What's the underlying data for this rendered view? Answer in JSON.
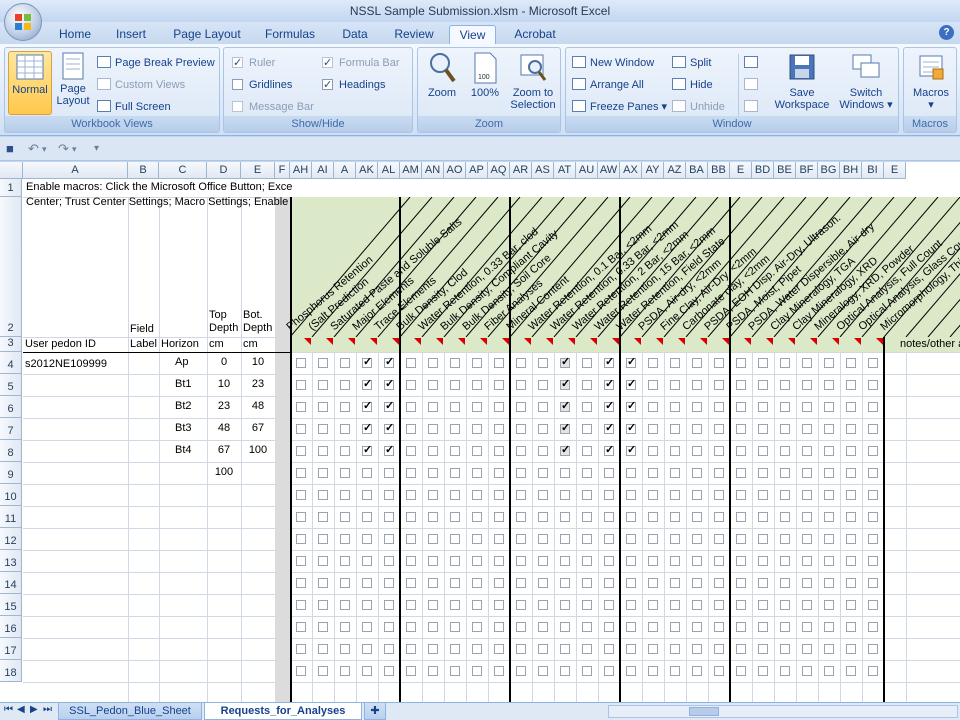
{
  "window": {
    "title": "NSSL Sample Submission.xlsm - Microsoft Excel",
    "help": "?"
  },
  "tabs": [
    "Home",
    "Insert",
    "Page Layout",
    "Formulas",
    "Data",
    "Review",
    "View",
    "Acrobat"
  ],
  "active_tab": "View",
  "ribbon": {
    "workbook_views": {
      "label": "Workbook Views",
      "normal": "Normal",
      "page_layout": "Page Layout",
      "page_break_preview": "Page Break Preview",
      "custom_views": "Custom Views",
      "full_screen": "Full Screen"
    },
    "show_hide": {
      "label": "Show/Hide",
      "ruler": "Ruler",
      "formula_bar": "Formula Bar",
      "gridlines": "Gridlines",
      "headings": "Headings",
      "message_bar": "Message Bar"
    },
    "zoom": {
      "label": "Zoom",
      "zoom": "Zoom",
      "hundred": "100%",
      "zoom_to_selection": "Zoom to Selection",
      "hundred_icon": "100"
    },
    "window": {
      "label": "Window",
      "new_window": "New Window",
      "arrange_all": "Arrange All",
      "freeze_panes": "Freeze Panes",
      "split": "Split",
      "hide": "Hide",
      "unhide": "Unhide",
      "save_workspace": "Save Workspace",
      "switch_windows": "Switch Windows"
    },
    "macros": {
      "label": "Macros",
      "macros": "Macros"
    }
  },
  "columns": [
    "A",
    "B",
    "C",
    "D",
    "E",
    "F",
    "AH",
    "AI",
    "A",
    "AK",
    "AL",
    "AM",
    "AN",
    "AO",
    "AP",
    "AQ",
    "AR",
    "AS",
    "AT",
    "AU",
    "AW",
    "AX",
    "AY",
    "AZ",
    "BA",
    "BB",
    "E",
    "BD",
    "BE",
    "BF",
    "BG",
    "BH",
    "BI",
    "E"
  ],
  "row_numbers": [
    "1",
    "2",
    "3",
    "4",
    "5",
    "6",
    "7",
    "8",
    "9",
    "10",
    "11",
    "12",
    "13",
    "14",
    "15",
    "16",
    "17",
    "18"
  ],
  "sheet": {
    "row1_text_line1": "Enable macros:  Click the Microsoft Office Button; Exce",
    "row1_text_line2": "Center; Trust Center Settings; Macro Settings; Enable a",
    "headers_row2": {
      "B": "Field",
      "D": "Top Depth",
      "E": "Bot. Depth"
    },
    "headers_row3": {
      "A": "User pedon ID",
      "B": "Label",
      "C": "Horizon",
      "D": "cm",
      "E": "cm",
      "notes": "notes/other a"
    },
    "pedon_id": "s2012NE109999",
    "horizons": [
      {
        "name": "Ap",
        "top": "0",
        "bottom": "10"
      },
      {
        "name": "Bt1",
        "top": "10",
        "bottom": "23"
      },
      {
        "name": "Bt2",
        "top": "23",
        "bottom": "48"
      },
      {
        "name": "Bt3",
        "top": "48",
        "bottom": "67"
      },
      {
        "name": "Bt4",
        "top": "67",
        "bottom": "100"
      },
      {
        "name": "",
        "top": "100",
        "bottom": ""
      }
    ],
    "analyses": [
      "Phosphorus Retention",
      "(Salt Prediction",
      "Saturated Paste and Soluble Salts",
      "Major Elements",
      "Trace Elements",
      "Bulk Density, Clod",
      "Water Retention, 0.33 Bar, clod",
      "Bulk Density, Compliant Cavity",
      "Bulk Density, Soil Core",
      "Fiber Analyses",
      "Mineral Content",
      "Water Retention, 0.1 Bar, <2mm",
      "Water Retention, 0.33 Bar, <2mm",
      "Water Retention, 2 Bar, <2mm",
      "Water Retention, 15 Bar, <2mm",
      "Water Retention, Field State",
      "PSDA, Air-dry, <2mm",
      "Fine Clay, Air-Dry, <2mm",
      "Carbonate clay, <2mm",
      "PSDA, EOH Disp. Air-Dry, Ultrason.",
      "PSDA, Moist, Pipet",
      "PSDA, Water Dispersible, Air-dry",
      "Clay Mineralogy, TGA",
      "Clay Mineralogy, XRD",
      "Mineralogy, XRD, Powder",
      "Optical Analysis, Full Count",
      "Optical Analysis, Glass Count",
      "Micromorphology, Thin Section"
    ],
    "checked_columns": [
      "AK",
      "AL",
      "AW",
      "AX"
    ],
    "grey_checked_columns": [
      "AT",
      "AW"
    ]
  },
  "sheet_tabs": [
    "SSL_Pedon_Blue_Sheet",
    "Requests_for_Analyses"
  ],
  "active_sheet": "Requests_for_Analyses",
  "colors": {
    "ribbon_text": "#15428b",
    "header_green": "#dce9c8",
    "comment_marker": "#d80000"
  }
}
